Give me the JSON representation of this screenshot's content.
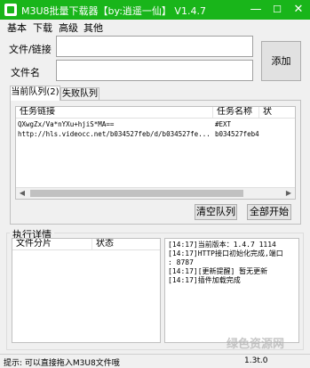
{
  "window": {
    "title": "M3U8批量下载器【by:逍遥一仙】  V1.4.7",
    "minimize": "—",
    "maximize": "☐",
    "close": "✕"
  },
  "menu": [
    "基本",
    "下载",
    "高级",
    "其他"
  ],
  "form": {
    "link_label": "文件/链接",
    "name_label": "文件名",
    "link_value": "",
    "name_value": "",
    "add_button": "添加"
  },
  "tabs": [
    {
      "label": "当前队列(2)",
      "active": true
    },
    {
      "label": "失败队列",
      "active": false
    }
  ],
  "queue": {
    "columns": [
      "任务链接",
      "任务名称",
      "状"
    ],
    "rows": [
      {
        "link": "QXwgZx/Va*nYXu+hjiS*MA==",
        "name": "#EXT"
      },
      {
        "link": "http://hls.videocc.net/b034527feb/d/b034527fe...",
        "name": "b034527feb4..."
      }
    ],
    "clear_button": "清空队列",
    "start_button": "全部开始"
  },
  "exec": {
    "group_title": "执行详情",
    "columns": [
      "文件分片",
      "状态"
    ],
    "log": [
      "[14:17]当前版本：1.4.7 1114",
      "[14:17]HTTP接口初始化完成,端口",
      ": 8787",
      "[14:17][更新提醒] 暂无更新",
      "[14:17]插件加载完成"
    ]
  },
  "status": {
    "hint": "提示: 可以直接拖入M3U8文件哦",
    "version": "1.3t.0"
  },
  "watermark": "绿色资源网"
}
